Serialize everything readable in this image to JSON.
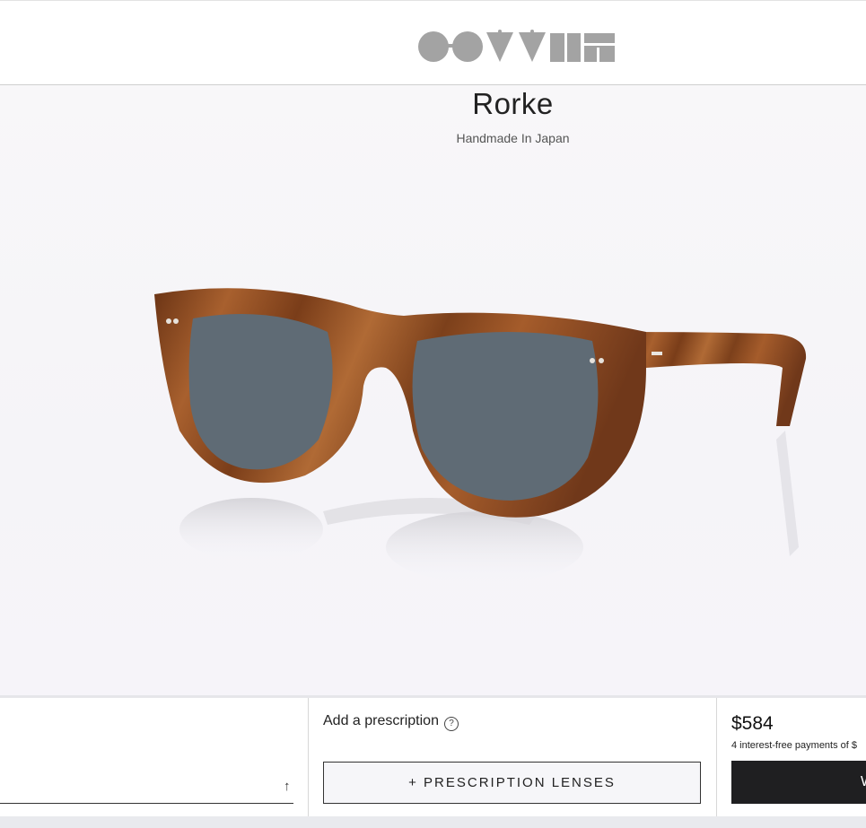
{
  "header": {
    "logo_icon": "brand-wordmark-logo"
  },
  "product": {
    "name": "Rorke",
    "subtitle": "Handmade In Japan",
    "image_icon": "sunglasses-product-image",
    "frame_color": "#8a4a24",
    "lens_color": "#5f6b75"
  },
  "purchase": {
    "prescription_label": "Add a prescription",
    "help_icon": "?",
    "prescription_button": "+ PRESCRIPTION LENSES",
    "price": "$584",
    "installments": "4 interest-free payments of $",
    "cta_label": "W",
    "up_arrow": "↑"
  },
  "colors": {
    "cta_bg": "#1f1f21",
    "logo_gray": "#a3a3a3"
  }
}
